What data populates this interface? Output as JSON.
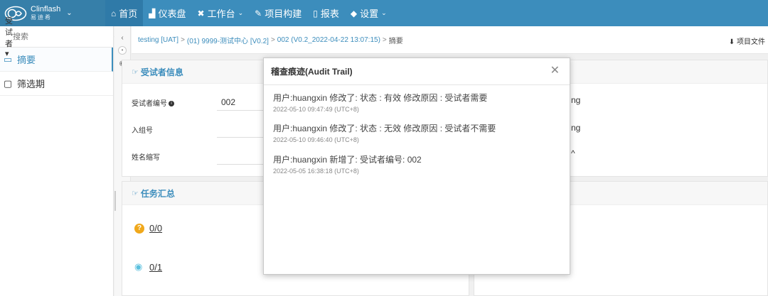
{
  "nav": {
    "brand_name": "Clinflash",
    "brand_sub": "易迪希",
    "items": [
      {
        "label": "首页",
        "icon": "home-icon",
        "active": true
      },
      {
        "label": "仪表盘",
        "icon": "bar-chart-icon"
      },
      {
        "label": "工作台",
        "icon": "tools-icon",
        "dropdown": true
      },
      {
        "label": "项目构建",
        "icon": "wrench-icon"
      },
      {
        "label": "报表",
        "icon": "clipboard-icon"
      },
      {
        "label": "设置",
        "icon": "cube-icon",
        "dropdown": true
      }
    ]
  },
  "sidebar": {
    "select_label": "受试者",
    "search_placeholder": "搜索",
    "items": [
      {
        "label": "摘要",
        "icon": "book-icon",
        "active": true
      },
      {
        "label": "筛选期",
        "icon": "folder-icon"
      }
    ]
  },
  "breadcrumb": {
    "items": [
      "testing [UAT]",
      "(01) 9999-测试中心 [V0.2]",
      "002 (V0.2_2022-04-22 13:07:15)"
    ],
    "current": "摘要",
    "project_file": "项目文件"
  },
  "subject_panel": {
    "title": "受试者信息",
    "rows": [
      {
        "label": "受试者编号",
        "value": "002",
        "info": true
      },
      {
        "label": "入组号",
        "value": ""
      },
      {
        "label": "姓名缩写",
        "value": ""
      }
    ],
    "right_fragments": [
      "ng",
      "ng",
      "^"
    ]
  },
  "task_panel": {
    "title": "任务汇总",
    "items": [
      {
        "icon": "question-icon",
        "value": "0/0"
      },
      {
        "icon": "eye-icon",
        "value": "0/1"
      }
    ]
  },
  "modal": {
    "title": "稽查痕迹(Audit Trail)",
    "entries": [
      {
        "text": "用户:huangxin 修改了: 状态 : 有效 修改原因 : 受试者需要",
        "time": "2022-05-10 09:47:49 (UTC+8)"
      },
      {
        "text": "用户:huangxin 修改了: 状态 : 无效 修改原因 : 受试者不需要",
        "time": "2022-05-10 09:46:40 (UTC+8)"
      },
      {
        "text": "用户:huangxin 新增了: 受试者编号: 002",
        "time": "2022-05-05 16:38:18 (UTC+8)"
      }
    ]
  },
  "colors": {
    "primary": "#3c8dbc",
    "nav_active": "#2f7aa8",
    "warning": "#f0a81b",
    "info": "#5bc0de"
  }
}
